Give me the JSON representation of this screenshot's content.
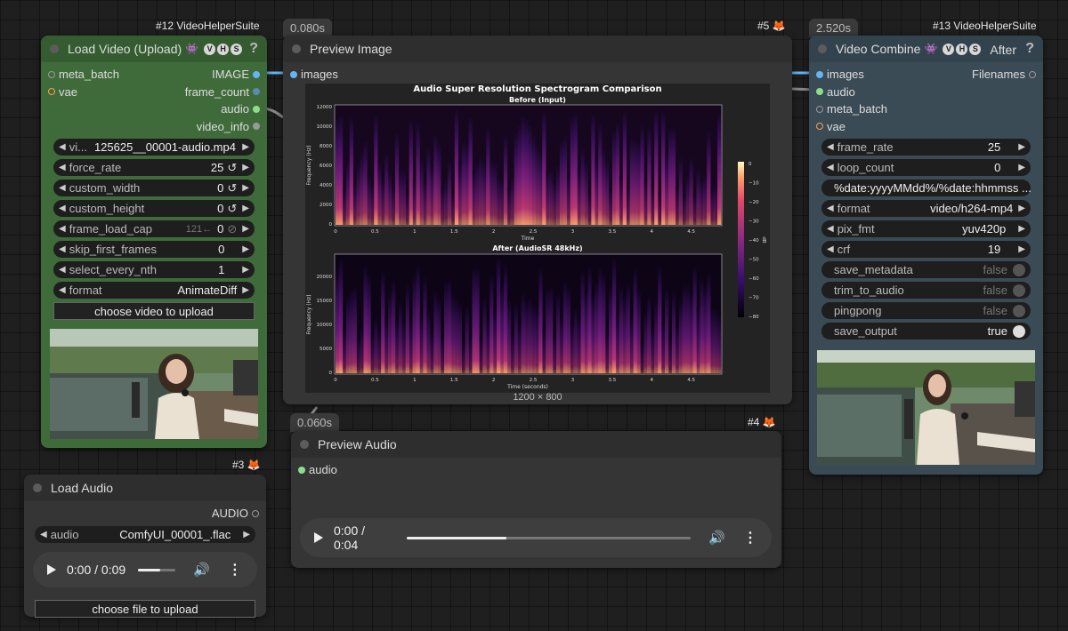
{
  "nodes": {
    "load_video": {
      "id_label": "#12 VideoHelperSuite",
      "title": "Load Video (Upload)",
      "badge": [
        "V",
        "H",
        "S"
      ],
      "help": "?",
      "outputs": [
        "IMAGE",
        "frame_count",
        "audio",
        "video_info"
      ],
      "inputs": [
        "meta_batch",
        "vae"
      ],
      "widgets": [
        {
          "label": "vi...",
          "value": "125625__00001-audio.mp4"
        },
        {
          "label": "force_rate",
          "value": "25"
        },
        {
          "label": "custom_width",
          "value": "0"
        },
        {
          "label": "custom_height",
          "value": "0"
        },
        {
          "label": "frame_load_cap",
          "hint": "121←",
          "value": "0"
        },
        {
          "label": "skip_first_frames",
          "value": "0"
        },
        {
          "label": "select_every_nth",
          "value": "1"
        },
        {
          "label": "format",
          "value": "AnimateDiff"
        }
      ],
      "upload_button": "choose video to upload"
    },
    "preview_image": {
      "timer": "0.080s",
      "id_label": "#5",
      "title": "Preview Image",
      "inputs": [
        "images"
      ],
      "size_caption": "1200 × 800"
    },
    "video_combine": {
      "timer": "2.520s",
      "id_label": "#13 VideoHelperSuite",
      "title": "Video Combine",
      "badge": [
        "V",
        "H",
        "S"
      ],
      "after": "After",
      "help": "?",
      "inputs": [
        "images",
        "audio",
        "meta_batch",
        "vae"
      ],
      "outputs": [
        "Filenames"
      ],
      "widgets": [
        {
          "label": "frame_rate",
          "value": "25"
        },
        {
          "label": "loop_count",
          "value": "0"
        },
        {
          "label": "",
          "value": "%date:yyyyMMdd%/%date:hhmmss ..."
        },
        {
          "label": "format",
          "value": "video/h264-mp4"
        },
        {
          "label": "pix_fmt",
          "value": "yuv420p"
        },
        {
          "label": "crf",
          "value": "19"
        },
        {
          "label": "save_metadata",
          "value": "false"
        },
        {
          "label": "trim_to_audio",
          "value": "false"
        },
        {
          "label": "pingpong",
          "value": "false"
        },
        {
          "label": "save_output",
          "value": "true"
        }
      ]
    },
    "preview_audio": {
      "timer": "0.060s",
      "id_label": "#4",
      "title": "Preview Audio",
      "inputs": [
        "audio"
      ],
      "player": {
        "time": "0:00 / 0:04",
        "progress": 0.35
      }
    },
    "load_audio": {
      "id_label": "#3",
      "title": "Load Audio",
      "outputs": [
        "AUDIO"
      ],
      "widget": {
        "label": "audio",
        "value": "ComfyUI_00001_.flac"
      },
      "player": {
        "time": "0:00 / 0:09",
        "volume": 0.6
      },
      "upload_button": "choose file to upload"
    }
  },
  "spectrogram": {
    "title": "Audio Super Resolution Spectrogram Comparison",
    "top_subtitle": "Before (Input)",
    "bottom_subtitle": "After (AudioSR 48kHz)",
    "top_ylabel": "Frequency (Hz)",
    "bottom_ylabel": "Frequency (Hz)",
    "top_xlabel": "Time",
    "bottom_xlabel": "Time (seconds)",
    "top_yticks": [
      "12000",
      "10000",
      "8000",
      "6000",
      "4000",
      "2000",
      "0"
    ],
    "bottom_yticks": [
      "20000",
      "15000",
      "10000",
      "5000",
      "0"
    ],
    "xticks": [
      "0",
      "0.5",
      "1",
      "1.5",
      "2",
      "2.5",
      "3",
      "3.5",
      "4",
      "4.5"
    ],
    "colorbar_ticks": [
      "0",
      "−10",
      "−20",
      "−30",
      "−40",
      "−50",
      "−60",
      "−70",
      "−80"
    ],
    "colorbar_unit": "dB"
  },
  "colors": {
    "green_node": "#3f6b3a",
    "green_title": "#355c30",
    "blue_node": "#3a4b55",
    "blue_title": "#33434d",
    "gray_node": "#353535",
    "gray_title": "#2e2e2e",
    "slot_image": "#64b5f6",
    "slot_audio": "#8bde8b",
    "slot_vae": "#ff9c4a",
    "slot_other": "#999999"
  }
}
